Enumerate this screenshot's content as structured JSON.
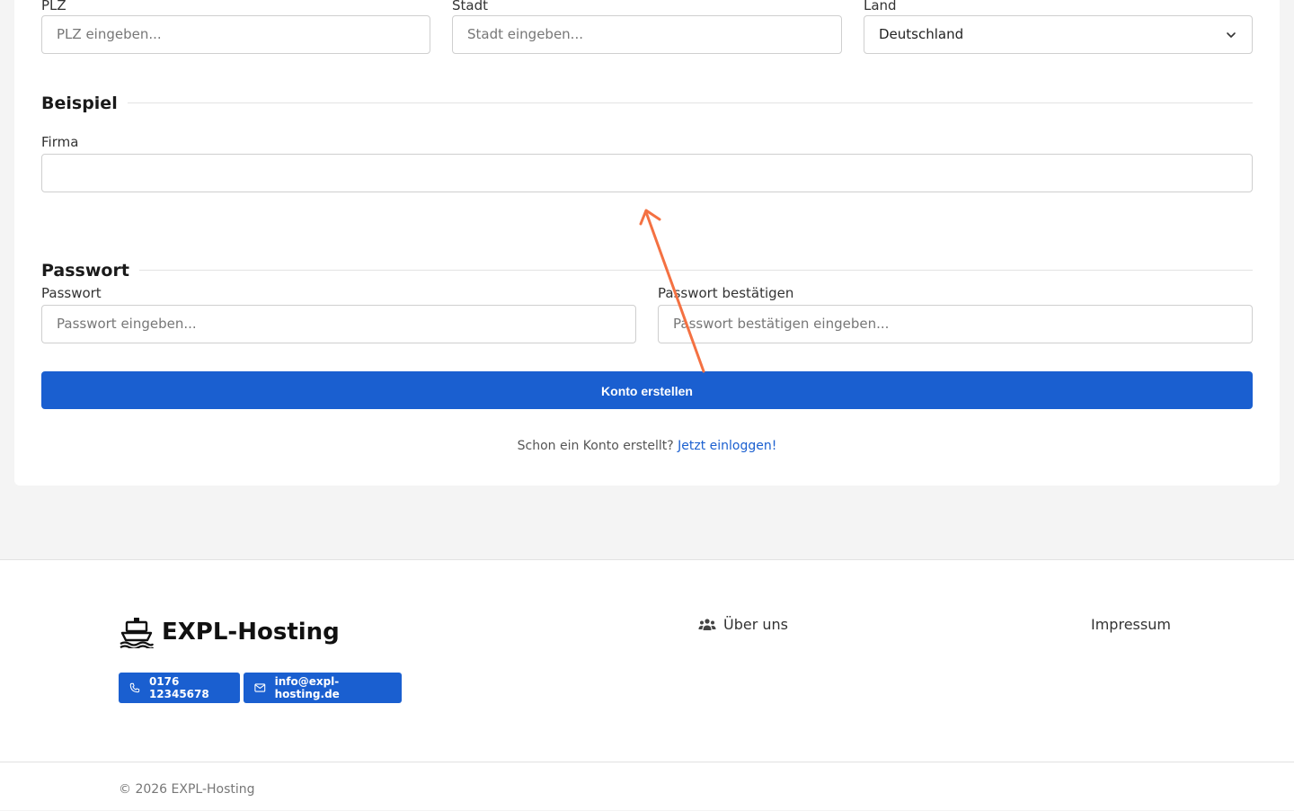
{
  "address": {
    "zip_label": "PLZ",
    "zip_placeholder": "PLZ eingeben...",
    "city_label": "Stadt",
    "city_placeholder": "Stadt eingeben...",
    "country_label": "Land",
    "country_value": "Deutschland"
  },
  "example_section": {
    "title": "Beispiel",
    "company_label": "Firma",
    "company_value": ""
  },
  "password_section": {
    "title": "Passwort",
    "password_label": "Passwort",
    "password_placeholder": "Passwort eingeben...",
    "confirm_label": "Passwort bestätigen",
    "confirm_placeholder": "Passwort bestätigen eingeben..."
  },
  "submit_label": "Konto erstellen",
  "login_prompt": {
    "text": "Schon ein Konto erstellt?",
    "link": "Jetzt einloggen!"
  },
  "footer": {
    "brand": "EXPL-Hosting",
    "phone": "0176 12345678",
    "email": "info@expl-hosting.de",
    "about": "Über uns",
    "imprint": "Impressum",
    "copyright": "© 2026 EXPL-Hosting"
  },
  "colors": {
    "primary": "#1a5fd0",
    "annotation_arrow": "#f47142",
    "page_bg": "#f4f4f4"
  }
}
